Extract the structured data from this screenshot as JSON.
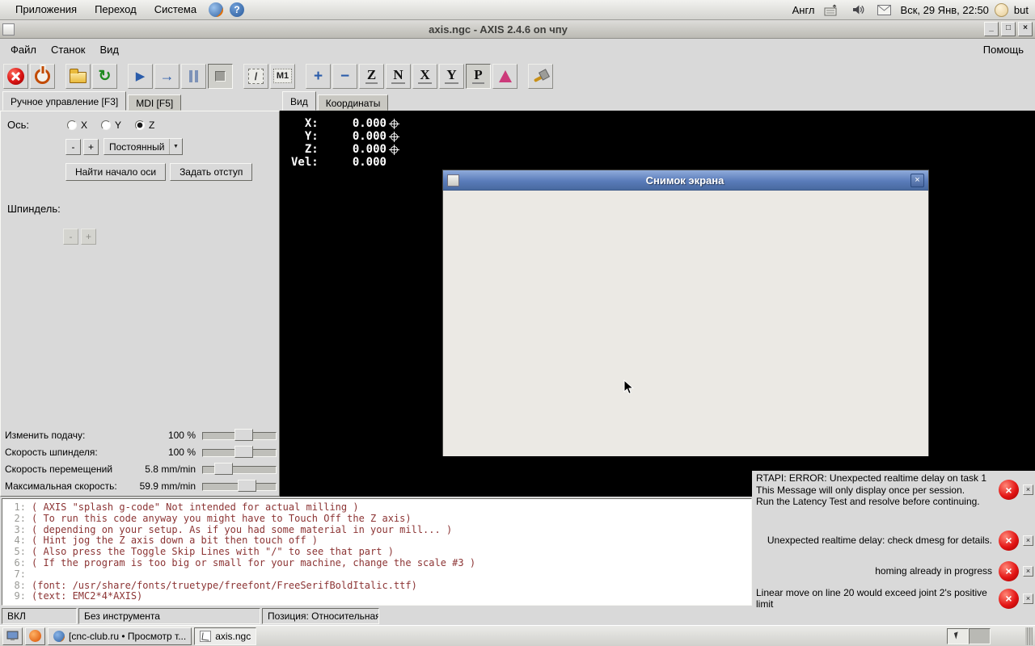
{
  "icons": {
    "close": "×",
    "minimize": "_",
    "maximize": "□",
    "chevron_down": "▼",
    "reload": "↻",
    "run": "▶",
    "run_from_line": "→",
    "zoom_in": "+",
    "zoom_out": "−",
    "help": "?"
  },
  "top_panel": {
    "menus": [
      {
        "label": "Приложения"
      },
      {
        "label": "Переход"
      },
      {
        "label": "Система"
      }
    ],
    "keyboard_layout": "Англ",
    "clock": "Вск, 29 Янв, 22:50",
    "user": "but"
  },
  "app_window": {
    "title": "axis.ngc - AXIS 2.4.6 on чпу",
    "menu_items": [
      {
        "label": "Файл"
      },
      {
        "label": "Станок"
      },
      {
        "label": "Вид"
      }
    ],
    "help_label": "Помощь",
    "toolbar": {
      "skip_label": "/",
      "m1_label": "M1",
      "view_buttons": [
        {
          "name": "view-top-z-button",
          "letter": "Z"
        },
        {
          "name": "view-rotated-top-button",
          "letter": "N"
        },
        {
          "name": "view-side-x-button",
          "letter": "X"
        },
        {
          "name": "view-front-y-button",
          "letter": "Y"
        },
        {
          "name": "view-perspective-p-button",
          "letter": "P",
          "toggled": true
        }
      ]
    },
    "left_tabs": [
      {
        "label": "Ручное управление [F3]",
        "active": true
      },
      {
        "label": "MDI [F5]",
        "active": false
      }
    ],
    "manual_panel": {
      "axis_label": "Ось:",
      "axis_options": [
        {
          "label": "X",
          "selected": false
        },
        {
          "label": "Y",
          "selected": false
        },
        {
          "label": "Z",
          "selected": true
        }
      ],
      "jog_minus": "-",
      "jog_plus": "+",
      "jog_mode": "Постоянный",
      "home_button": "Найти начало оси",
      "offset_button": "Задать отступ",
      "spindle_label": "Шпиндель:",
      "spindle_minus": "-",
      "spindle_plus": "+"
    },
    "sliders": [
      {
        "label": "Изменить подачу:",
        "value": "100",
        "unit": "%",
        "pct": 56
      },
      {
        "label": "Скорость шпинделя:",
        "value": "100",
        "unit": "%",
        "pct": 56
      },
      {
        "label": "Скорость перемещений",
        "value": "5.8",
        "unit": "mm/min",
        "pct": 29
      },
      {
        "label": "Максимальная скорость:",
        "value": "59.9",
        "unit": "mm/min",
        "pct": 61
      }
    ],
    "right_tabs": [
      {
        "label": "Вид",
        "active": true
      },
      {
        "label": "Координаты",
        "active": false
      }
    ],
    "dro": [
      {
        "label": "X:",
        "value": "0.000",
        "homed": true
      },
      {
        "label": "Y:",
        "value": "0.000",
        "homed": true
      },
      {
        "label": "Z:",
        "value": "0.000",
        "homed": true
      },
      {
        "label": "Vel:",
        "value": "0.000",
        "homed": false
      }
    ],
    "gcode_lines": [
      {
        "num": "1:",
        "text": "( AXIS \"splash g-code\" Not intended for actual milling )"
      },
      {
        "num": "2:",
        "text": "( To run this code anyway you might have to Touch Off the Z axis)"
      },
      {
        "num": "3:",
        "text": "( depending on your setup. As if you had some material in your mill... )"
      },
      {
        "num": "4:",
        "text": "( Hint jog the Z axis down a bit then touch off )"
      },
      {
        "num": "5:",
        "text": "( Also press the Toggle Skip Lines with \"/\" to see that part )"
      },
      {
        "num": "6:",
        "text": "( If the program is too big or small for your machine, change the scale #3 )"
      },
      {
        "num": "7:",
        "text": ""
      },
      {
        "num": "8:",
        "text": "(font: /usr/share/fonts/truetype/freefont/FreeSerifBoldItalic.ttf)"
      },
      {
        "num": "9:",
        "text": "(text: EMC2*4*AXIS)"
      }
    ],
    "status_bar": [
      {
        "label": "ВКЛ"
      },
      {
        "label": "Без инструмента"
      },
      {
        "label": "Позиция: Относительная Наст"
      }
    ]
  },
  "dialog": {
    "title": "Снимок экрана"
  },
  "errors": [
    {
      "text": "RTAPI: ERROR: Unexpected realtime delay on task 1\nThis Message will only display once per session.\nRun the Latency Test and resolve before continuing.",
      "align_right": false,
      "row": "r1"
    },
    {
      "text": "Unexpected realtime delay: check dmesg for details.",
      "align_right": true,
      "row": "r2"
    },
    {
      "text": "homing already in progress",
      "align_right": true,
      "row": "r3"
    },
    {
      "text": "Linear move on line 20 would exceed joint 2's positive limit",
      "align_right": false,
      "row": "r4"
    }
  ],
  "taskbar": {
    "windows": [
      {
        "label": "[cnc-club.ru • Просмотр т...",
        "active": false,
        "icon": "firefox"
      },
      {
        "label": "axis.ngc",
        "active": true,
        "icon": "axis"
      }
    ]
  }
}
